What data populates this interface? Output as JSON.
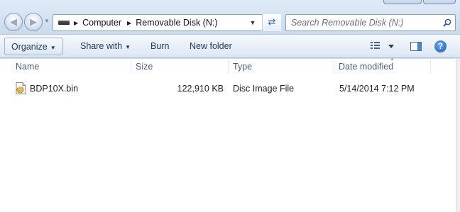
{
  "address_bar": {
    "crumbs": [
      "Computer",
      "Removable Disk (N:)"
    ]
  },
  "search": {
    "placeholder": "Search Removable Disk (N:)"
  },
  "toolbar": {
    "organize_label": "Organize",
    "share_label": "Share with",
    "burn_label": "Burn",
    "new_folder_label": "New folder",
    "help_label": "?"
  },
  "columns": {
    "name": "Name",
    "size": "Size",
    "type": "Type",
    "date_modified": "Date modified"
  },
  "files": [
    {
      "name": "BDP10X.bin",
      "size": "122,910 KB",
      "type": "Disc Image File",
      "date_modified": "5/14/2014 7:12 PM",
      "icon": "disc-image-file-icon"
    }
  ],
  "colors": {
    "accent": "#1e395b",
    "chrome": "#cfdff0",
    "link_blue": "#2f6bb6"
  }
}
